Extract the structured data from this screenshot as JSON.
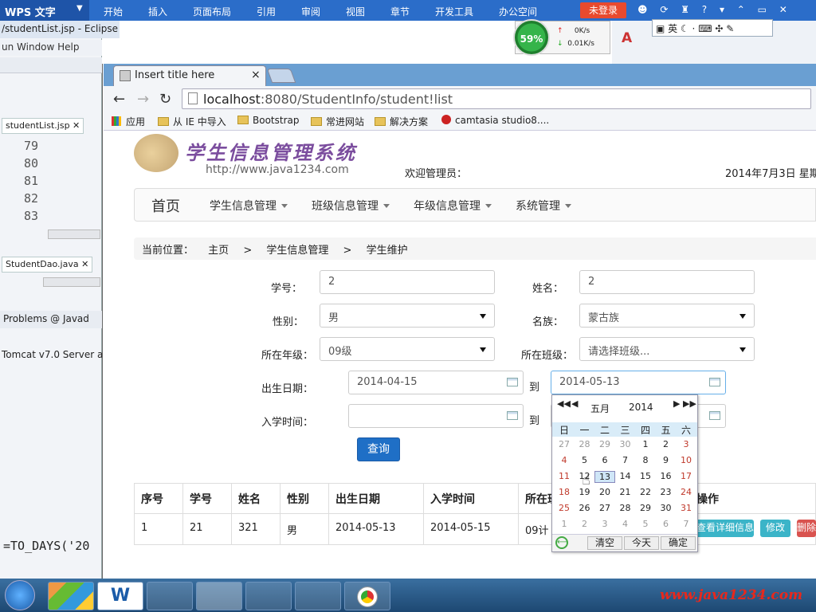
{
  "wps": {
    "logo": "WPS 文字",
    "menu": [
      "开始",
      "插入",
      "页面布局",
      "引用",
      "审阅",
      "视图",
      "章节",
      "开发工具",
      "办公空间"
    ],
    "login": "未登录",
    "tools": "☻ ⟳ ♜ ? ▾ ⌃ ▭ ✕"
  },
  "eclipse": {
    "title": "/studentList.jsp - Eclipse",
    "menu": "un  Window  Help",
    "editor_tab": "studentList.jsp",
    "line_numbers": [
      "79",
      "80",
      "81",
      "82",
      "83"
    ],
    "dao_tab": "StudentDao.java",
    "problems": "Problems  @ Javad",
    "server": "Tomcat v7.0 Server a",
    "code_fragment": "=TO_DAYS('20"
  },
  "speed": {
    "percent": "59%",
    "up": "0K/s",
    "down": "0.01K/s"
  },
  "ime": {
    "label": "英"
  },
  "browser": {
    "tab_title": "Insert title here",
    "tab_close": "×",
    "url_host": "localhost",
    "url_rest": ":8080/StudentInfo/student!list",
    "bookmarks": [
      "应用",
      "从 IE 中导入",
      "Bootstrap",
      "常进网站",
      "解决方案",
      "camtasia studio8...."
    ]
  },
  "page": {
    "logo_title": "学生信息管理系统",
    "logo_url": "http://www.java1234.com",
    "welcome": "欢迎管理员：",
    "date": "2014年7月3日 星期",
    "nav": {
      "home": "首页",
      "items": [
        "学生信息管理",
        "班级信息管理",
        "年级信息管理",
        "系统管理"
      ]
    },
    "breadcrumb": {
      "prefix": "当前位置：",
      "home": "主页",
      "sep": ">",
      "l1": "学生信息管理",
      "l2": "学生维护"
    },
    "form": {
      "stuno_label": "学号：",
      "stuno_value": "2",
      "name_label": "姓名：",
      "name_value": "2",
      "sex_label": "性别：",
      "sex_value": "男",
      "nation_label": "名族：",
      "nation_value": "蒙古族",
      "grade_label": "所在年级：",
      "grade_value": "09级",
      "class_label": "所在班级：",
      "class_value": "请选择班级...",
      "birth_label": "出生日期：",
      "birth_from": "2014-04-15",
      "to": "到",
      "birth_to": "2014-05-13",
      "enroll_label": "入学时间：",
      "enroll_from": "",
      "enroll_to": "",
      "query": "查询"
    },
    "table": {
      "headers": [
        "序号",
        "学号",
        "姓名",
        "性别",
        "出生日期",
        "入学时间",
        "所在班",
        "操作"
      ],
      "row": [
        "1",
        "21",
        "321",
        "男",
        "2014-05-13",
        "2014-05-15",
        "09计"
      ],
      "actions": [
        "查看详细信息",
        "修改",
        "删除"
      ]
    }
  },
  "calendar": {
    "month": "五月",
    "year": "2014",
    "weekdays": [
      "日",
      "一",
      "二",
      "三",
      "四",
      "五",
      "六"
    ],
    "weeks": [
      [
        "27",
        "28",
        "29",
        "30",
        "1",
        "2",
        "3"
      ],
      [
        "4",
        "5",
        "6",
        "7",
        "8",
        "9",
        "10"
      ],
      [
        "11",
        "12",
        "13",
        "14",
        "15",
        "16",
        "17"
      ],
      [
        "18",
        "19",
        "20",
        "21",
        "22",
        "23",
        "24"
      ],
      [
        "25",
        "26",
        "27",
        "28",
        "29",
        "30",
        "31"
      ],
      [
        "1",
        "2",
        "3",
        "4",
        "5",
        "6",
        "7"
      ]
    ],
    "selected": "13",
    "clear": "清空",
    "today": "今天",
    "ok": "确定"
  },
  "watermark": "www.java1234.com",
  "colors": {
    "wps_blue": "#2b6dc9",
    "primary": "#1f6fc6",
    "info": "#3bb4c8",
    "danger": "#d9534f",
    "weekend": "#c0392b"
  }
}
